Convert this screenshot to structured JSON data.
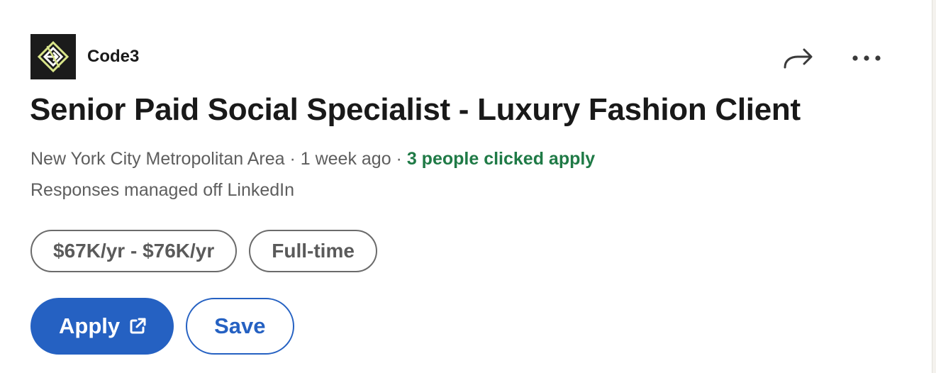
{
  "company": {
    "name": "Code3",
    "logo_icon": "code3-logo"
  },
  "header_actions": {
    "share_icon": "share-arrow-icon",
    "more_icon": "ellipsis-icon"
  },
  "job": {
    "title": "Senior Paid Social Specialist - Luxury Fashion Client",
    "location": "New York City Metropolitan Area",
    "separator": " · ",
    "posted": "1 week ago",
    "applicants": "3 people clicked apply",
    "responses": "Responses managed off LinkedIn"
  },
  "pills": {
    "salary": "$67K/yr - $76K/yr",
    "employment_type": "Full-time"
  },
  "buttons": {
    "apply_label": "Apply",
    "apply_icon": "external-link-icon",
    "save_label": "Save"
  },
  "colors": {
    "accent": "#2561c2",
    "applicants_green": "#1f7a46",
    "title": "#191919",
    "muted": "#5e5e5e"
  }
}
